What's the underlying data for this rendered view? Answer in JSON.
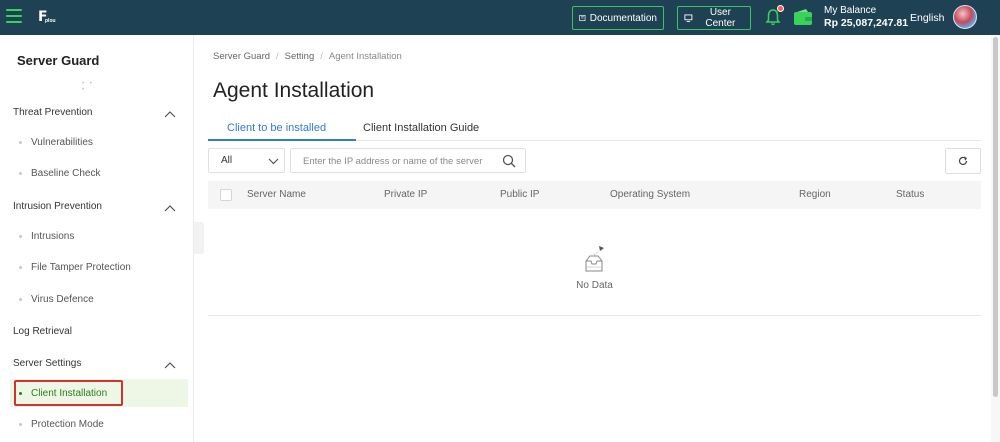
{
  "topbar": {
    "logo_text": "F",
    "logo_sub": "plou",
    "documentation": "Documentation",
    "user_center": "User Center",
    "balance_label": "My Balance",
    "balance_amount": "Rp 25,087,247.81",
    "language": "English"
  },
  "sidebar": {
    "title": "Server Guard",
    "groups": [
      {
        "label": "Threat Prevention",
        "items": [
          "Vulnerabilities",
          "Baseline Check"
        ]
      },
      {
        "label": "Intrusion Prevention",
        "items": [
          "Intrusions",
          "File Tamper Protection",
          "Virus Defence"
        ]
      },
      {
        "label": "Log Retrieval",
        "items": []
      },
      {
        "label": "Server Settings",
        "items": [
          "Client Installation",
          "Protection Mode"
        ]
      }
    ]
  },
  "main": {
    "breadcrumb": [
      "Server Guard",
      "Setting",
      "Agent Installation"
    ],
    "title": "Agent Installation",
    "tabs": [
      "Client to be installed",
      "Client Installation Guide"
    ],
    "filter_value": "All",
    "search_placeholder": "Enter the IP address or name of the server",
    "columns": [
      "Server Name",
      "Private IP",
      "Public IP",
      "Operating System",
      "Region",
      "Status"
    ],
    "empty_text": "No Data"
  },
  "colors": {
    "topbar_bg": "#1e4253",
    "accent_green": "#3bd15c",
    "tab_blue": "#2f7bd6",
    "active_text": "#2e7d1e",
    "highlight_red": "#d2332f"
  }
}
